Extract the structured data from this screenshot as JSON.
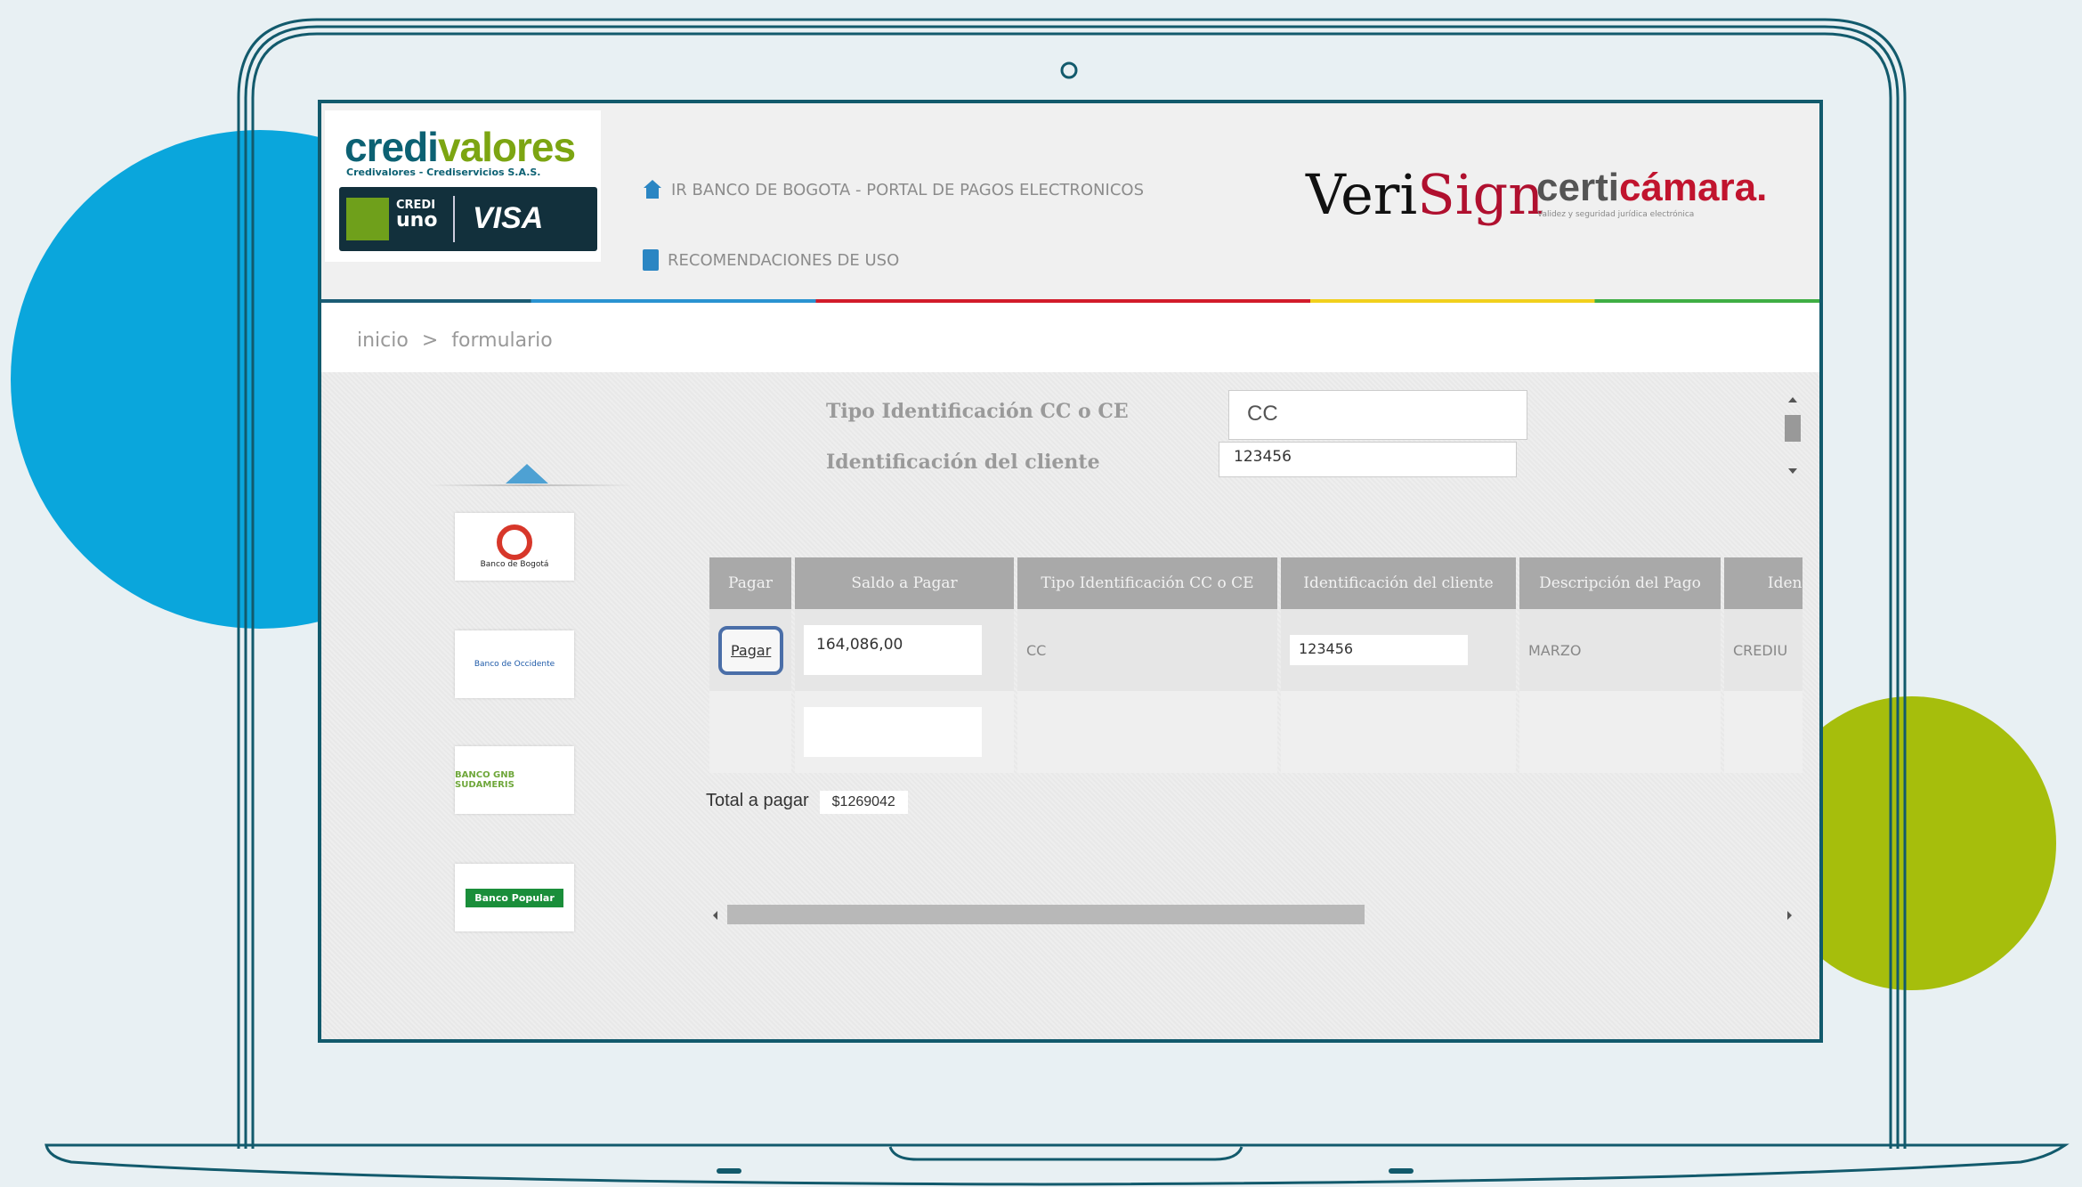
{
  "brand": {
    "name_a": "credi",
    "name_b": "valores",
    "subtitle": "Credivalores - Crediservicios S.A.S.",
    "card_credi": "CREDI",
    "card_uno": "uno",
    "card_visa": "VISA"
  },
  "nav": {
    "portal_label": "IR BANCO DE BOGOTA - PORTAL DE PAGOS ELECTRONICOS",
    "reco_label": "RECOMENDACIONES DE USO"
  },
  "partners": {
    "verisign_a": "Veri",
    "verisign_b": "Sign",
    "certi_a": "certi",
    "certi_b": "cámara.",
    "certi_sub": "Validez y seguridad jurídica electrónica"
  },
  "breadcrumb": {
    "home": "inicio",
    "sep": ">",
    "current": "formulario"
  },
  "form": {
    "tipo_label": "Tipo Identificación CC o CE",
    "tipo_value": "CC",
    "ident_label": "Identificación del cliente",
    "ident_value": "123456"
  },
  "banks": {
    "b1": "Banco de Bogotá",
    "b2": "Banco de Occidente",
    "b3": "BANCO GNB SUDAMERIS",
    "b4": "Banco Popular"
  },
  "table": {
    "headers": [
      "Pagar",
      "Saldo a Pagar",
      "Tipo Identificación CC o CE",
      "Identificación del cliente",
      "Descripción del Pago",
      "Identifi"
    ],
    "row": {
      "pay_label": "Pagar",
      "saldo": "164,086,00",
      "tipo": "CC",
      "ident": "123456",
      "descripcion": "MARZO",
      "extra": "CREDIU"
    }
  },
  "total": {
    "label": "Total a pagar",
    "value": "$1269042"
  },
  "colors": {
    "accent_blue": "#0aa6dc",
    "accent_green": "#a6be0c",
    "frame": "#125a6c"
  }
}
